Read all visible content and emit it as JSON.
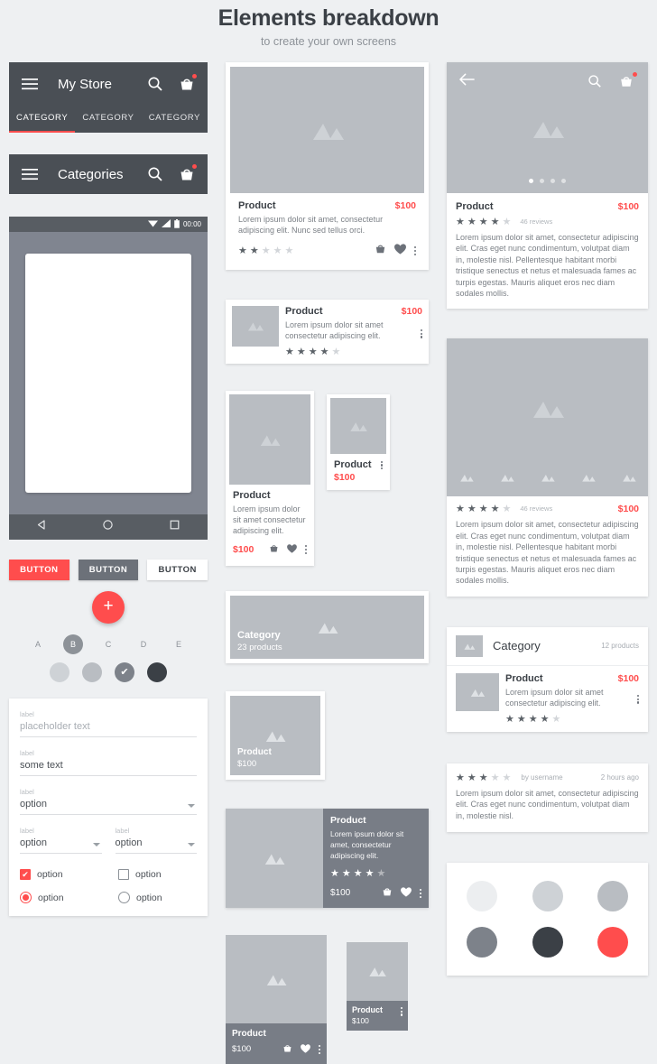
{
  "header": {
    "title": "Elements breakdown",
    "subtitle": "to create your own screens"
  },
  "appbars": [
    {
      "title": "My Store",
      "menu_icon": "hamburger-icon",
      "search_icon": "search-icon",
      "cart_icon": "cart-icon",
      "tabs": [
        {
          "label": "CATEGORY",
          "active": true
        },
        {
          "label": "CATEGORY",
          "active": false
        },
        {
          "label": "CATEGORY",
          "active": false
        }
      ]
    },
    {
      "title": "Categories",
      "menu_icon": "hamburger-icon",
      "search_icon": "search-icon",
      "cart_icon": "cart-icon"
    }
  ],
  "phone": {
    "status_time": "00:00",
    "status_icons": [
      "wifi-icon",
      "signal-icon",
      "battery-icon"
    ],
    "nav": [
      "back-triangle-icon",
      "home-circle-icon",
      "recents-square-icon"
    ]
  },
  "buttons": {
    "primary": "BUTTON",
    "secondary": "BUTTON",
    "flat": "BUTTON",
    "fab_label": "+",
    "chips": [
      {
        "label": "A",
        "selected": false
      },
      {
        "label": "B",
        "selected": true
      },
      {
        "label": "C",
        "selected": false
      },
      {
        "label": "D",
        "selected": false
      },
      {
        "label": "E",
        "selected": false
      }
    ],
    "swatches": [
      {
        "color": "#ced2d6",
        "checked": false
      },
      {
        "color": "#b9bdc2",
        "checked": false
      },
      {
        "color": "#7d828a",
        "checked": true
      },
      {
        "color": "#3b4046",
        "checked": false
      }
    ]
  },
  "form": {
    "label": "label",
    "placeholder_value": "placeholder text",
    "text_value": "some text",
    "select_value": "option",
    "select_value_2": "option",
    "select_value_3": "option",
    "checkbox_checked_label": "option",
    "checkbox_unchecked_label": "option",
    "radio_checked_label": "option",
    "radio_unchecked_label": "option"
  },
  "products": {
    "name": "Product",
    "price": "$100",
    "desc_short": "Lorem ipsum dolor sit amet, consectetur adipiscing elit. Nunc sed tellus orci.",
    "desc_list": "Lorem ipsum dolor sit amet consectetur adipiscing elit.",
    "desc_grid": "Lorem ipsum dolor sit amet consectetur adipiscing elit.",
    "desc_wide": "Lorem ipsum dolor sit amet, consectetur adipiscing elit.",
    "desc_long": "Lorem ipsum dolor sit amet, consectetur adipiscing elit. Cras eget nunc condimentum, volutpat diam in, molestie nisl. Pellentesque habitant morbi tristique senectus et netus et malesuada fames ac turpis egestas. Mauris aliquet eros nec diam sodales mollis.",
    "reviews_count": "46 reviews",
    "ratings": {
      "card_hero": 2,
      "list_item": 4,
      "detail": 4,
      "gallery": 4,
      "wide": 4,
      "category_list": 4,
      "review": 3
    }
  },
  "category": {
    "banner_name": "Category",
    "banner_count": "23 products",
    "list_name": "Category",
    "list_count": "12 products"
  },
  "review": {
    "author": "by username",
    "time": "2 hours ago",
    "text": "Lorem ipsum dolor sit amet, consectetur adipiscing elit. Cras eget nunc condimentum, volutpat diam in, molestie nisl."
  },
  "palette": [
    "#eceef0",
    "#ced2d6",
    "#b9bdc2",
    "#7d828a",
    "#3b4046",
    "#ff4d4d"
  ],
  "colors": {
    "accent": "#ff4d4d",
    "dark": "#4a4f55",
    "placeholder": "#b9bdc2",
    "bg": "#eef0f2"
  }
}
